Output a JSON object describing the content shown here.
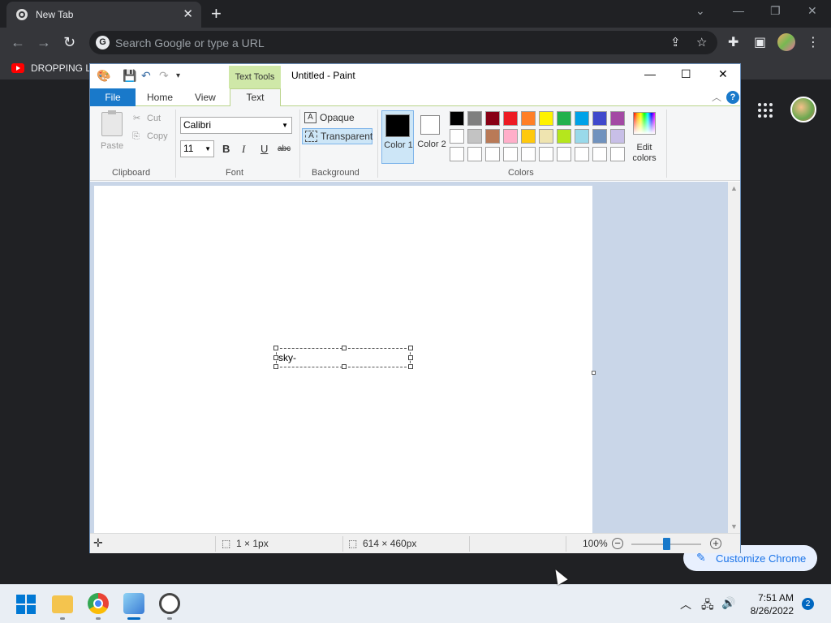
{
  "browser": {
    "tab_title": "New Tab",
    "new_tab_symbol": "+",
    "omnibox_placeholder": "Search Google or type a URL",
    "bookmark_label": "DROPPING LE",
    "customize_label": "Customize Chrome"
  },
  "paint": {
    "contextual_tab": "Text Tools",
    "window_title": "Untitled - Paint",
    "tabs": {
      "file": "File",
      "home": "Home",
      "view": "View",
      "text": "Text"
    },
    "clipboard": {
      "paste": "Paste",
      "cut": "Cut",
      "copy": "Copy",
      "group": "Clipboard"
    },
    "font": {
      "family": "Calibri",
      "size": "11",
      "bold": "B",
      "italic": "I",
      "underline": "U",
      "strike": "abc",
      "group": "Font"
    },
    "background": {
      "opaque": "Opaque",
      "transparent": "Transparent",
      "group": "Background",
      "selected": "transparent"
    },
    "colors": {
      "color1_label": "Color 1",
      "color2_label": "Color 2",
      "edit_label": "Edit colors",
      "group": "Colors",
      "color1": "#000000",
      "color2": "#ffffff",
      "palette_row1": [
        "#000000",
        "#7f7f7f",
        "#880015",
        "#ed1c24",
        "#ff7f27",
        "#fff200",
        "#22b14c",
        "#00a2e8",
        "#3f48cc",
        "#a349a4"
      ],
      "palette_row2": [
        "#ffffff",
        "#c3c3c3",
        "#b97a57",
        "#ffaec9",
        "#ffc90e",
        "#efe4b0",
        "#b5e61d",
        "#99d9ea",
        "#7092be",
        "#c8bfe7"
      ],
      "palette_row3": [
        "#ffffff",
        "#ffffff",
        "#ffffff",
        "#ffffff",
        "#ffffff",
        "#ffffff",
        "#ffffff",
        "#ffffff",
        "#ffffff",
        "#ffffff"
      ]
    },
    "canvas_text": "sky-",
    "status": {
      "selection": "1 × 1px",
      "canvas_size": "614 × 460px",
      "zoom": "100%",
      "zoom_level_fraction": 0.5
    }
  },
  "taskbar": {
    "time": "7:51 AM",
    "date": "8/26/2022",
    "notifications": "2"
  }
}
